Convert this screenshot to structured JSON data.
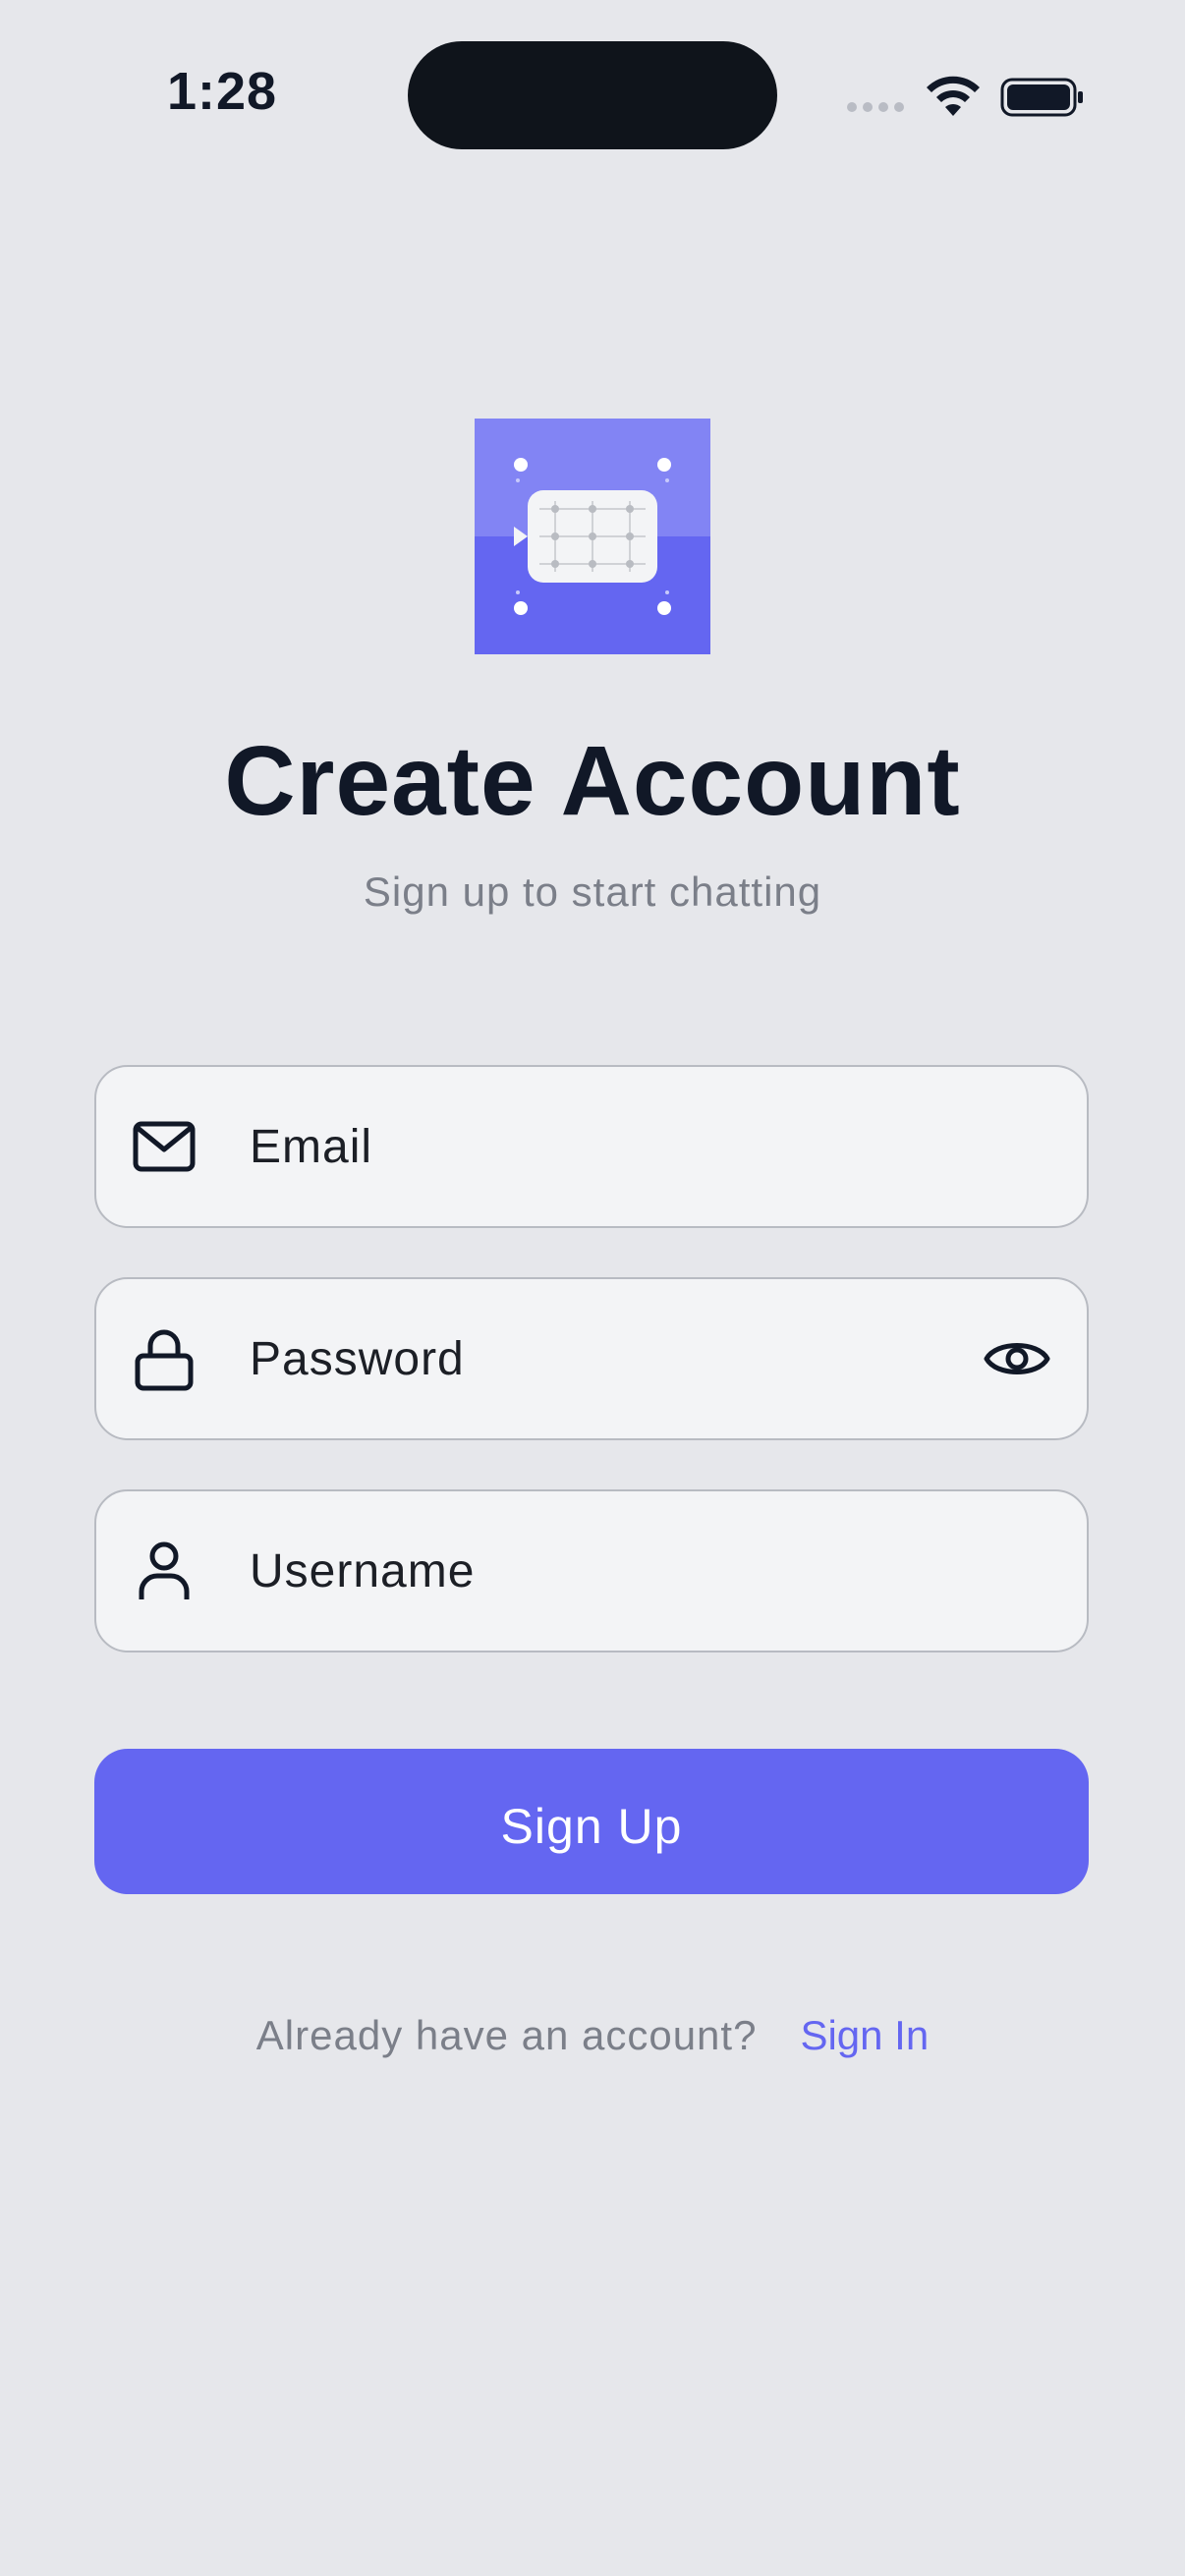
{
  "status_bar": {
    "time": "1:28",
    "icons": [
      "signal-dots",
      "wifi-icon",
      "battery-icon"
    ]
  },
  "logo": {
    "icon": "chat-grid-logo",
    "colors": {
      "top": "#8284f4",
      "bottom": "#6466f1",
      "bubble": "#f3f4f6"
    }
  },
  "header": {
    "title": "Create Account",
    "subtitle": "Sign up to start chatting"
  },
  "form": {
    "email": {
      "icon": "mail-icon",
      "placeholder": "Email",
      "value": ""
    },
    "password": {
      "icon": "lock-icon",
      "placeholder": "Password",
      "value": "",
      "toggle_icon": "eye-icon"
    },
    "username": {
      "icon": "user-icon",
      "placeholder": "Username",
      "value": ""
    },
    "submit_label": "Sign Up"
  },
  "footer": {
    "prompt": "Already have an account?",
    "link_label": "Sign In"
  },
  "colors": {
    "background": "#e6e7eb",
    "accent": "#6466f1",
    "field_bg": "#f3f4f6",
    "field_border": "#b8bbc2",
    "muted_text": "#7b7f89",
    "primary_text": "#111827"
  }
}
